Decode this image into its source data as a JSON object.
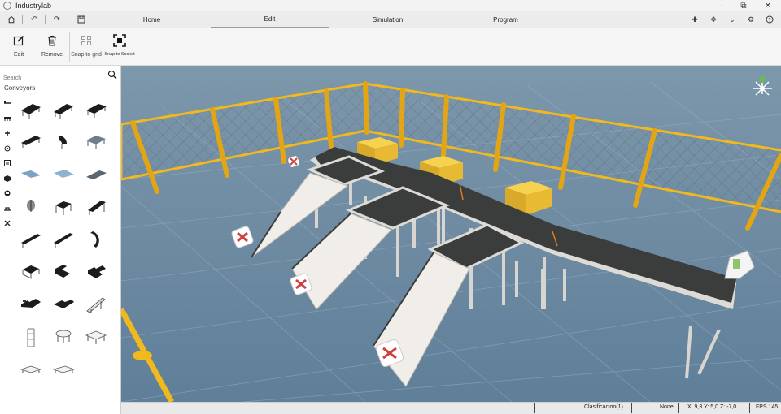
{
  "app": {
    "title": "Industrylab"
  },
  "tabs": [
    {
      "label": "Home",
      "active": false
    },
    {
      "label": "Edit",
      "active": true
    },
    {
      "label": "Simulation",
      "active": false
    },
    {
      "label": "Program",
      "active": false
    }
  ],
  "toolbar": {
    "edit_label": "Edit",
    "remove_label": "Remove",
    "snap_grid_label": "Snap to grid",
    "snap_socket_label": "Snap to Socket"
  },
  "sidebar": {
    "search_placeholder": "Search",
    "section_title": "Conveyors",
    "categories": [
      "conveyor-line-icon",
      "roller-icon",
      "plus-icon",
      "sensor-icon",
      "panel-icon",
      "box-icon",
      "robot-icon",
      "pusher-icon",
      "tools-icon"
    ]
  },
  "status": {
    "object": "Clasificacion(1)",
    "selection": "None",
    "coordinates": "X: 9,3  Y: 5,0  Z: -7,0",
    "fps": "FPS 145"
  },
  "colors": {
    "fence": "#f2b91e",
    "floor": "#6b8aa3",
    "belt": "#3a3d3c",
    "frame": "#dedbd6",
    "box": "#f0c53a"
  }
}
